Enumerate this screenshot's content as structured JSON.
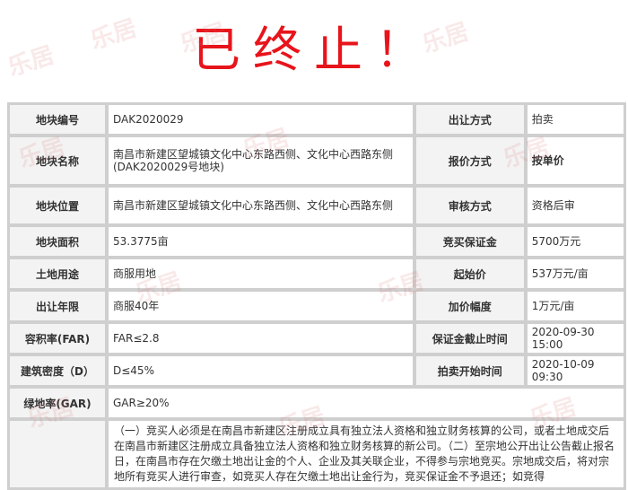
{
  "headline": "已终止！",
  "watermark_text": "乐居",
  "table": {
    "row1": {
      "k1": "地块编号",
      "v1": "DAK2020029",
      "k2": "出让方式",
      "v2": "拍卖"
    },
    "row2": {
      "k1": "地块名称",
      "v1": "南昌市新建区望城镇文化中心东路西侧、文化中心西路东侧(DAK2020029号地块)",
      "k2": "报价方式",
      "v2": "按单价"
    },
    "row3": {
      "k1": "地块位置",
      "v1": "南昌市新建区望城镇文化中心东路西侧、文化中心西路东侧",
      "k2": "审核方式",
      "v2": "资格后审"
    },
    "row4": {
      "k1": "地块面积",
      "v1": "53.3775亩",
      "k2": "竞买保证金",
      "v2": "5700万元"
    },
    "row5": {
      "k1": "土地用途",
      "v1": "商服用地",
      "k2": "起始价",
      "v2": "537万元/亩"
    },
    "row6": {
      "k1": "出让年限",
      "v1": "商服40年",
      "k2": "加价幅度",
      "v2": "1万元/亩"
    },
    "row7": {
      "k1": "容积率(FAR)",
      "v1": "FAR≤2.8",
      "k2": "保证金截止时间",
      "v2": "2020-09-30 15:00"
    },
    "row8": {
      "k1": "建筑密度（D）",
      "v1": "D≤45%",
      "k2": "拍卖开始时间",
      "v2": "2020-10-09 09:30"
    },
    "row9": {
      "k1": "绿地率(GAR)",
      "v1": "GAR≥20%"
    },
    "row10": {
      "v1": "（一）竞买人必须是在南昌市新建区注册成立具有独立法人资格和独立财务核算的公司，或者土地成交后在南昌市新建区注册成立具备独立法人资格和独立财务核算的新公司。（二）至宗地公开出让公告截止报名日，在南昌市存在欠缴土地出让金的个人、企业及其关联企业，不得参与宗地竞买。宗地成交后，将对宗地所有竞买人进行审查，如竞买人存在欠缴土地出让金行为，竞买保证金不予退还；如竞得"
    }
  }
}
